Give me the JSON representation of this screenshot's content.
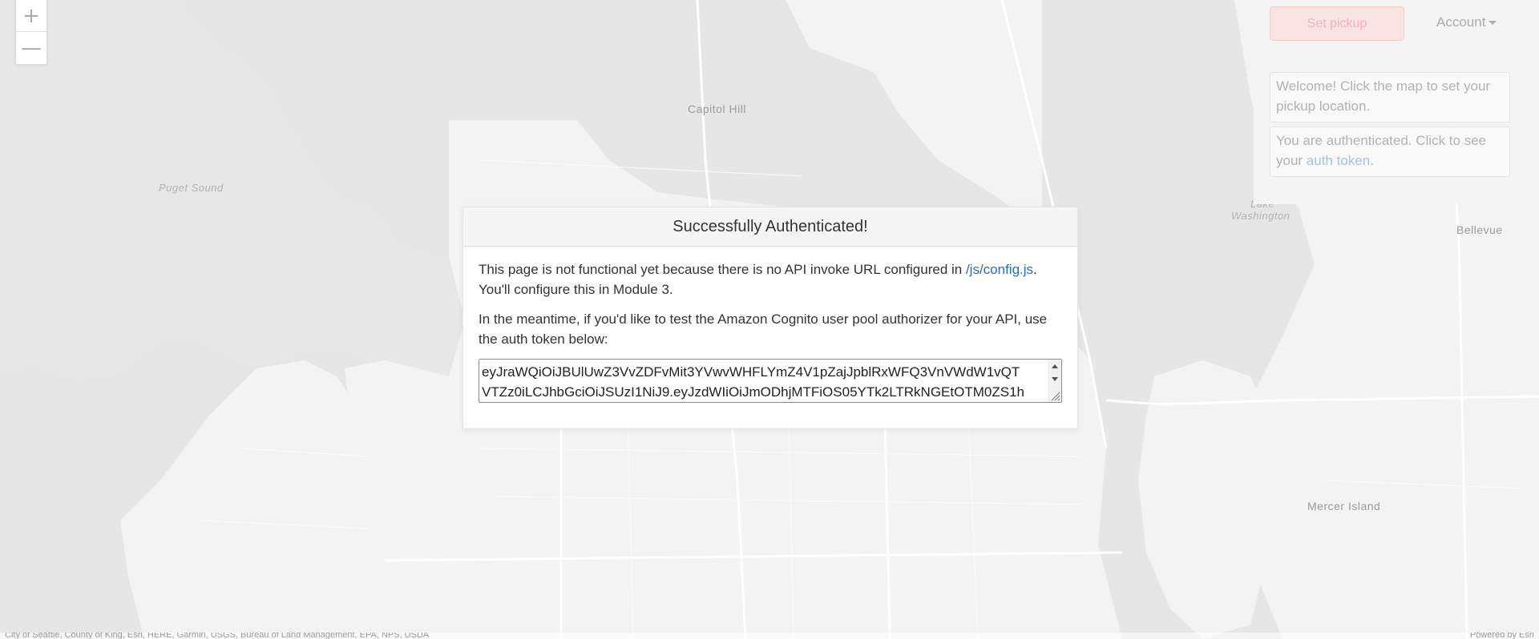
{
  "map": {
    "labels": {
      "capitol_hill": "Capitol Hill",
      "puget_sound": "Puget Sound",
      "lake_washington_1": "Lake",
      "lake_washington_2": "Washington",
      "bellevue": "Bellevue",
      "mercer_island": "Mercer Island"
    },
    "zoom_in": "+",
    "zoom_out": "—",
    "attribution_left": "City of Seattle, County of King, Esri, HERE, Garmin, USGS, Bureau of Land Management, EPA, NPS, USDA",
    "attribution_right": "Powered by Esri",
    "colors": {
      "land": "#f4f4f4",
      "water": "#e6e6e6",
      "road": "#ffffff"
    }
  },
  "side_panel": {
    "pickup_label": "Set pickup",
    "account_label": "Account",
    "welcome_text": "Welcome! Click the map to set your pickup location.",
    "auth_text_prefix": "You are authenticated. Click to see your ",
    "auth_link": "auth token",
    "auth_text_suffix": "."
  },
  "modal": {
    "title": "Successfully Authenticated!",
    "para1_prefix": "This page is not functional yet because there is no API invoke URL configured in ",
    "para1_link": "/js/config.js",
    "para1_suffix": ". You'll configure this in Module 3.",
    "para2": "In the meantime, if you'd like to test the Amazon Cognito user pool authorizer for your API, use the auth token below:",
    "token_line1": "eyJraWQiOiJBUlUwZ3VvZDFvMit3YVwvWHFLYmZ4V1pZajJpblRxWFQ3VnVWdW1vQT",
    "token_line2": "VTZz0iLCJhbGciOiJSUzI1NiJ9.eyJzdWIiOiJmODhjMTFiOS05YTk2LTRkNGEtOTM0ZS1h"
  }
}
